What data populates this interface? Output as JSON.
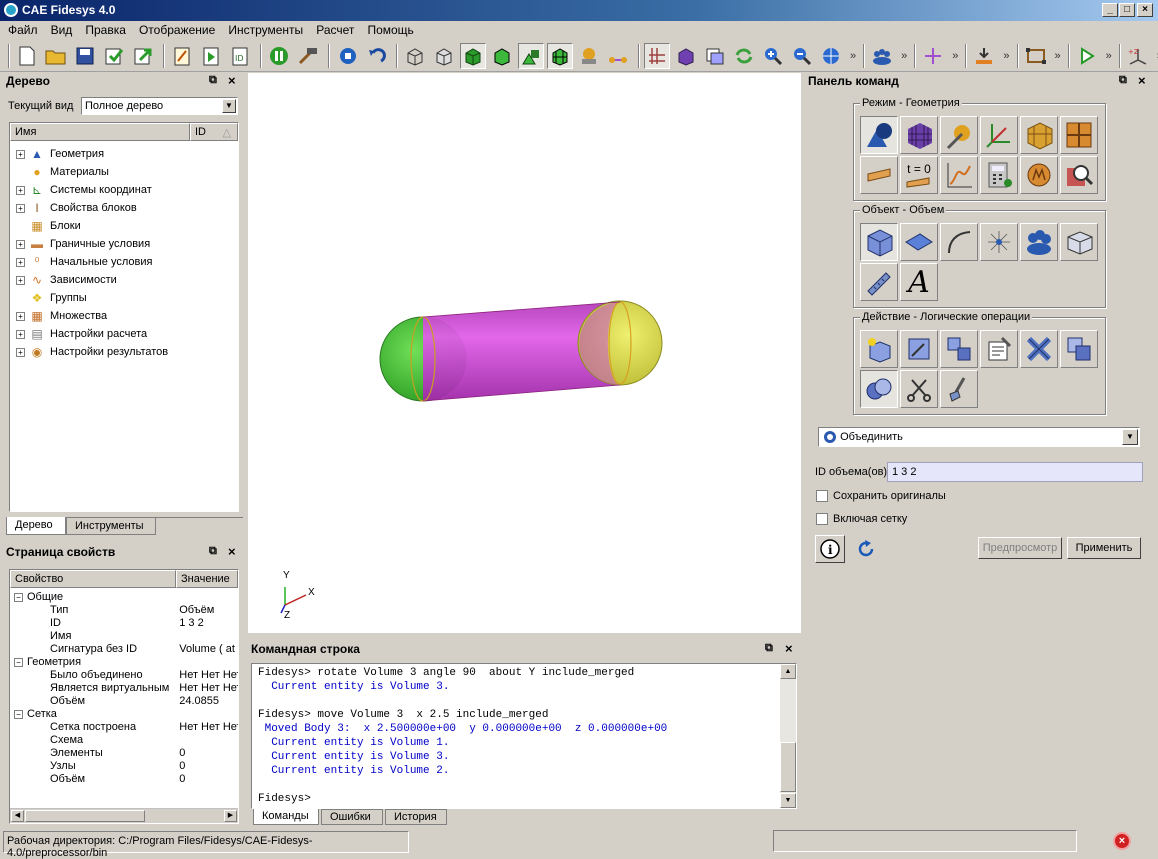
{
  "window": {
    "title": "CAE Fidesys 4.0"
  },
  "menu": [
    "Файл",
    "Вид",
    "Правка",
    "Отображение",
    "Инструменты",
    "Расчет",
    "Помощь"
  ],
  "tree_panel": {
    "title": "Дерево",
    "view_label": "Текущий вид",
    "view_value": "Полное дерево",
    "col_name": "Имя",
    "col_id": "ID",
    "items": [
      {
        "label": "Геометрия",
        "icon": "geometry-icon",
        "expandable": true
      },
      {
        "label": "Материалы",
        "icon": "materials-icon",
        "expandable": false
      },
      {
        "label": "Системы координат",
        "icon": "coordinate-systems-icon",
        "expandable": true
      },
      {
        "label": "Свойства блоков",
        "icon": "block-properties-icon",
        "expandable": true
      },
      {
        "label": "Блоки",
        "icon": "blocks-icon",
        "expandable": false
      },
      {
        "label": "Граничные условия",
        "icon": "boundary-conditions-icon",
        "expandable": true
      },
      {
        "label": "Начальные условия",
        "icon": "initial-conditions-icon",
        "expandable": true
      },
      {
        "label": "Зависимости",
        "icon": "dependencies-icon",
        "expandable": true
      },
      {
        "label": "Группы",
        "icon": "groups-icon",
        "expandable": false
      },
      {
        "label": "Множества",
        "icon": "sets-icon",
        "expandable": true
      },
      {
        "label": "Настройки расчета",
        "icon": "calc-settings-icon",
        "expandable": true
      },
      {
        "label": "Настройки результатов",
        "icon": "results-settings-icon",
        "expandable": true
      }
    ],
    "tabs": [
      "Дерево",
      "Инструменты"
    ]
  },
  "props_panel": {
    "title": "Страница свойств",
    "col_prop": "Свойство",
    "col_value": "Значение",
    "rows": [
      {
        "level": 0,
        "key": "Общие",
        "value": ""
      },
      {
        "level": 1,
        "key": "Тип",
        "value": "Объём"
      },
      {
        "level": 1,
        "key": "ID",
        "value": "1 3 2"
      },
      {
        "level": 1,
        "key": "Имя",
        "value": ""
      },
      {
        "level": 1,
        "key": "Сигнатура без ID",
        "value": "Volume ( at C"
      },
      {
        "level": 0,
        "key": "Геометрия",
        "value": ""
      },
      {
        "level": 1,
        "key": "Было объединено",
        "value": "Нет Нет Нет"
      },
      {
        "level": 1,
        "key": "Является виртуальным",
        "value": "Нет Нет Нет"
      },
      {
        "level": 1,
        "key": "Объём",
        "value": "24.0855"
      },
      {
        "level": 0,
        "key": "Сетка",
        "value": ""
      },
      {
        "level": 1,
        "key": "Сетка построена",
        "value": "Нет Нет Нет"
      },
      {
        "level": 1,
        "key": "Схема",
        "value": ""
      },
      {
        "level": 1,
        "key": "Элементы",
        "value": "0"
      },
      {
        "level": 1,
        "key": "Узлы",
        "value": "0"
      },
      {
        "level": 1,
        "key": "Объём",
        "value": "0"
      }
    ]
  },
  "viewport": {
    "axis_x": "X",
    "axis_y": "Y",
    "axis_z": "Z"
  },
  "console": {
    "title": "Командная строка",
    "lines": [
      {
        "text": "Fidesys> rotate Volume 3 angle 90  about Y include_merged",
        "color": "black"
      },
      {
        "text": "  Current entity is Volume 3.",
        "color": "blue"
      },
      {
        "text": "",
        "color": "black"
      },
      {
        "text": "Fidesys> move Volume 3  x 2.5 include_merged",
        "color": "black"
      },
      {
        "text": " Moved Body 3:  x 2.500000e+00  y 0.000000e+00  z 0.000000e+00",
        "color": "blue"
      },
      {
        "text": "  Current entity is Volume 1.",
        "color": "blue"
      },
      {
        "text": "  Current entity is Volume 3.",
        "color": "blue"
      },
      {
        "text": "  Current entity is Volume 2.",
        "color": "blue"
      },
      {
        "text": "",
        "color": "black"
      },
      {
        "text": "Fidesys> ",
        "color": "black"
      }
    ],
    "tabs": [
      "Команды",
      "Ошибки",
      "История"
    ]
  },
  "command_panel": {
    "title": "Панель команд",
    "mode_group": "Режим - Геометрия",
    "object_group": "Объект - Объем",
    "action_group": "Действие - Логические операции",
    "operation_value": "Объединить",
    "volume_id_label": "ID объема(ов)",
    "volume_id_value": "1 3 2",
    "keep_originals_label": "Сохранить оригиналы",
    "include_mesh_label": "Включая сетку",
    "preview_label": "Предпросмотр",
    "apply_label": "Применить"
  },
  "statusbar": {
    "workdir": "Рабочая директория: C:/Program Files/Fidesys/CAE-Fidesys-4.0/preprocessor/bin"
  },
  "colors": {
    "cylinder": "#d24fd8",
    "left_cap": "#4fc83a",
    "right_cap": "#d8d84a",
    "accent": "#0a246a"
  }
}
